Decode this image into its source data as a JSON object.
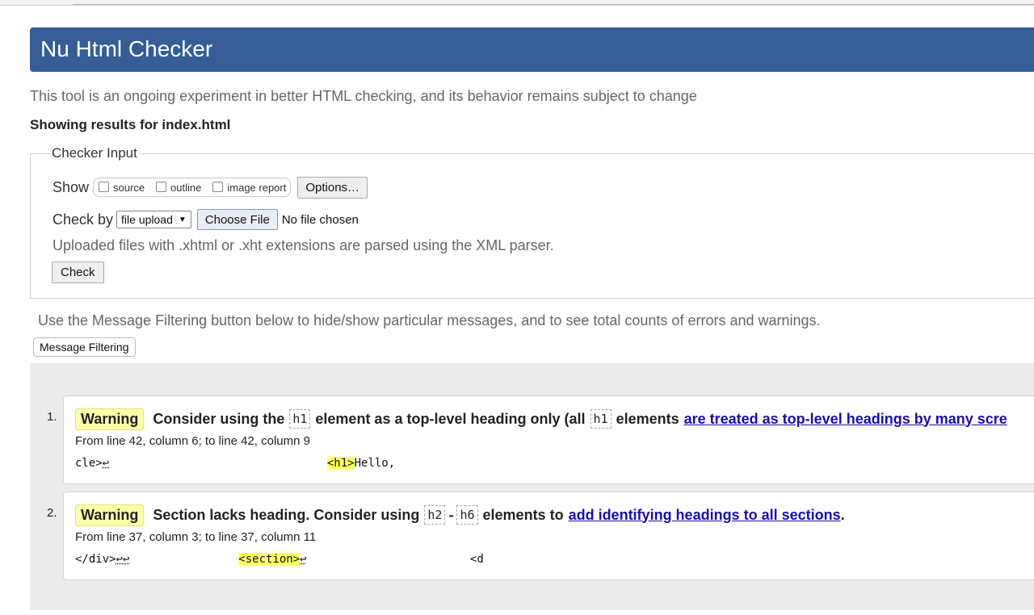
{
  "app": {
    "title": "Nu Html Checker",
    "intro": "This tool is an ongoing experiment in better HTML checking, and its behavior remains subject to change",
    "showing": "Showing results for index.html"
  },
  "checker_input": {
    "legend": "Checker Input",
    "show_label": "Show",
    "show_options": [
      "source",
      "outline",
      "image report"
    ],
    "options_button": "Options…",
    "check_by_label": "Check by",
    "check_by_value": "file upload",
    "choose_file_button": "Choose File",
    "no_file_text": "No file chosen",
    "uploaded_note": "Uploaded files with .xhtml or .xht extensions are parsed using the XML parser.",
    "check_button": "Check"
  },
  "filter": {
    "note": "Use the Message Filtering button below to hide/show particular messages, and to see total counts of errors and warnings.",
    "button": "Message Filtering"
  },
  "messages": [
    {
      "number": "1.",
      "type": "Warning",
      "text_a": "Consider using the",
      "code_a": "h1",
      "text_b": "element as a top-level heading only (all",
      "code_b": "h1",
      "text_c": "elements",
      "link": "are treated as top-level headings by many scre",
      "location": "From line 42, column 6; to line 42, column 9",
      "extract_pre": "cle>",
      "extract_lf": "↩",
      "extract_gap": "                                ",
      "extract_hl": "<h1>",
      "extract_post": "Hello,"
    },
    {
      "number": "2.",
      "type": "Warning",
      "text_a": "Section lacks heading. Consider using",
      "code_a": "h2",
      "dash": "-",
      "code_b": "h6",
      "text_b": "elements to",
      "link": "add identifying headings to all sections",
      "period": ".",
      "location": "From line 37, column 3; to line 37, column 11",
      "extract_pre": "</div>",
      "extract_lf": "↩↩",
      "extract_gap": "                ",
      "extract_hl": "<section>",
      "extract_lf2": "↩",
      "extract_gap2": "                        ",
      "extract_post": "<d"
    }
  ]
}
